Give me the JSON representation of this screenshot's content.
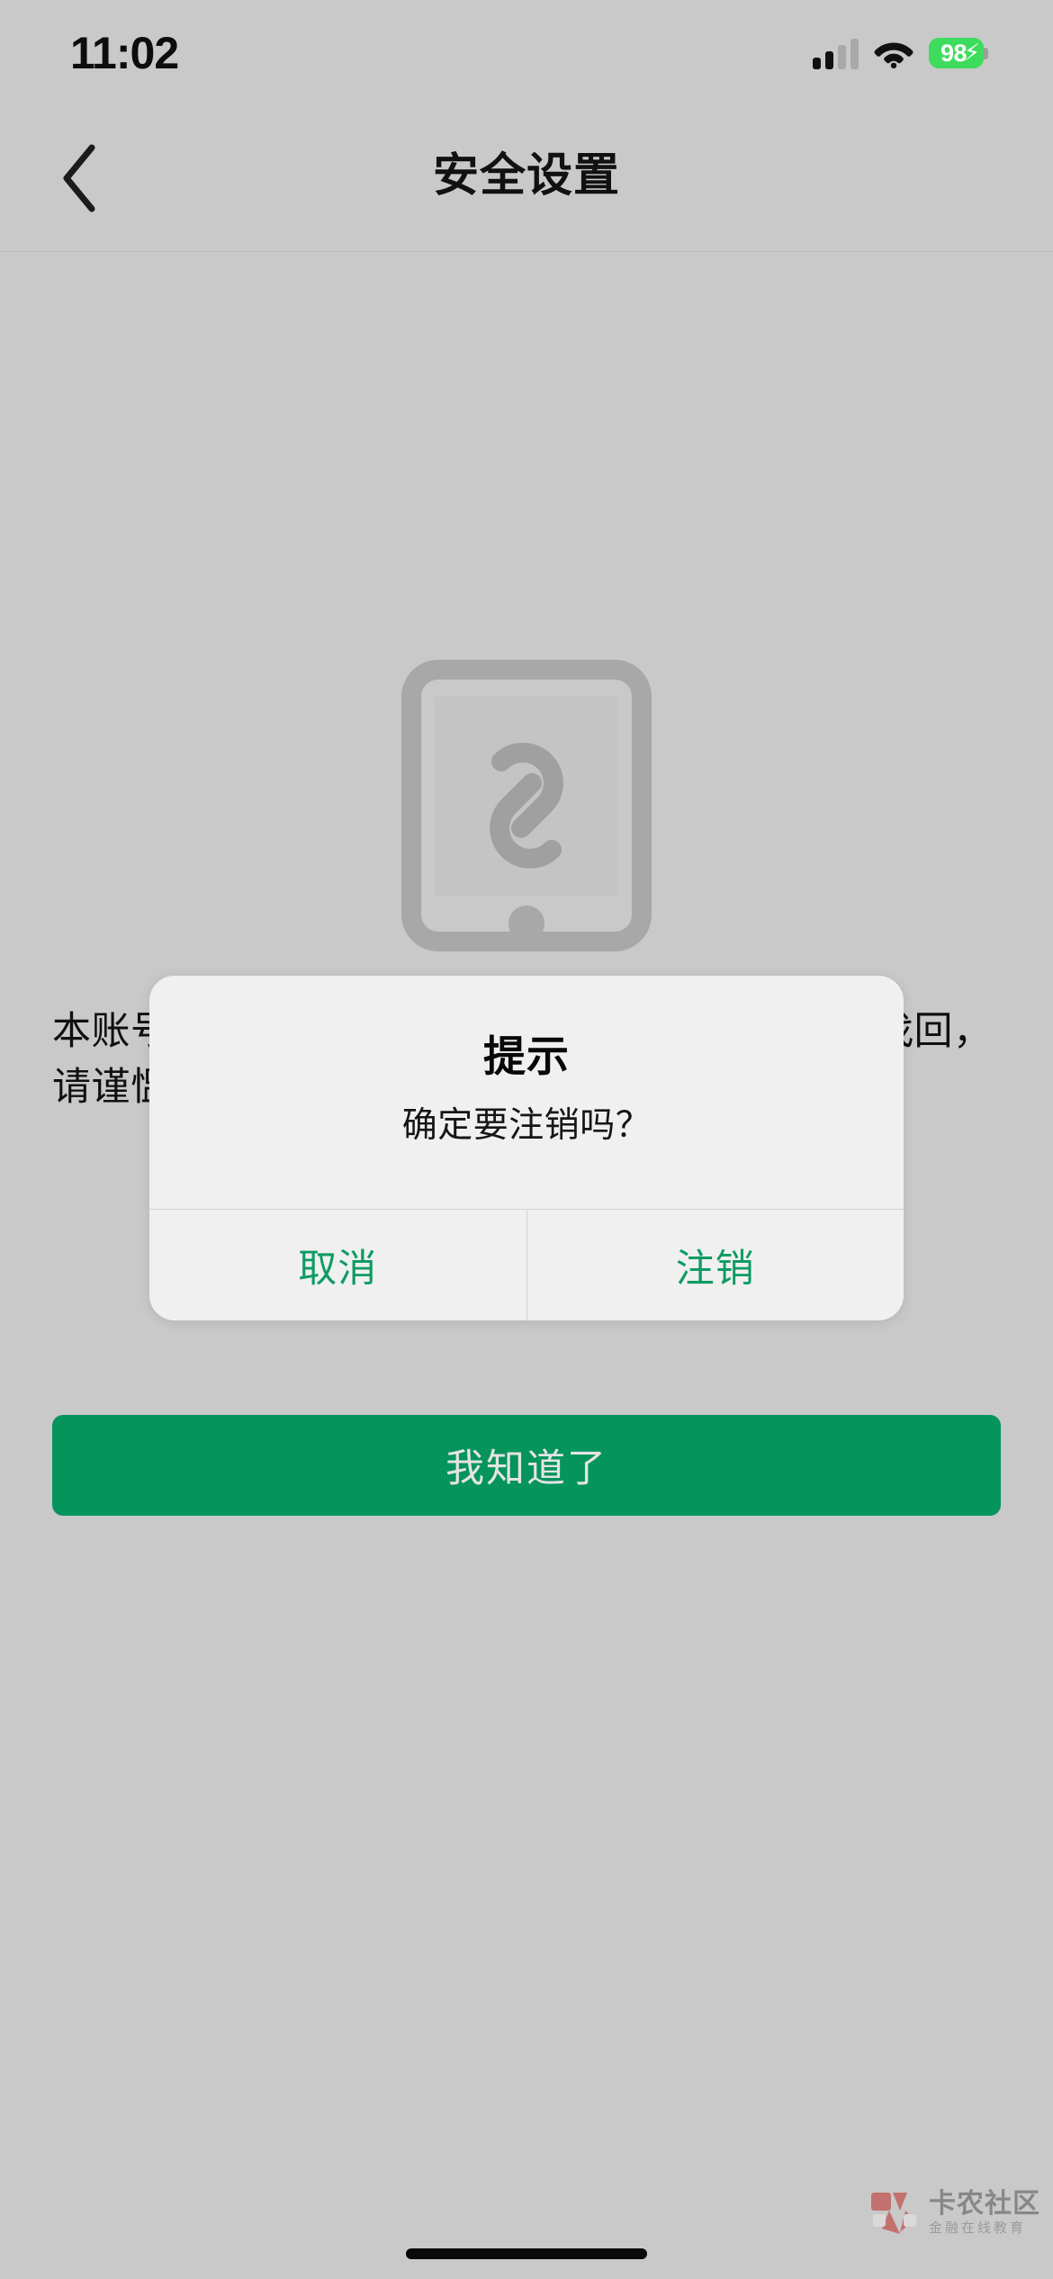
{
  "status_bar": {
    "time": "11:02",
    "signal_icon": "cellular-bars-icon",
    "wifi_icon": "wifi-icon",
    "battery": {
      "percent": "98",
      "charging_glyph": "⚡",
      "charging": true,
      "fill_color": "#3ddc5c"
    }
  },
  "nav": {
    "back_icon": "chevron-left-icon",
    "title": "安全设置"
  },
  "main": {
    "illustration_icon": "phone-link-icon",
    "description": "本账号注销后将无法登录该APP中的财产将无法找回，请谨慍操作！",
    "ack_label": "我知道了",
    "ack_color": "#05945c"
  },
  "alert": {
    "title": "提示",
    "message": "确定要注销吗？",
    "cancel_label": "取消",
    "confirm_label": "注销",
    "action_color": "#0f9b63",
    "background": "#f0f0f0"
  },
  "watermark": {
    "logo_icon": "kanong-logo-icon",
    "name": "卡农社区",
    "tagline": "金融在线教育",
    "logo_color": "#c0504d"
  },
  "system": {
    "home_indicator": "home-indicator"
  }
}
